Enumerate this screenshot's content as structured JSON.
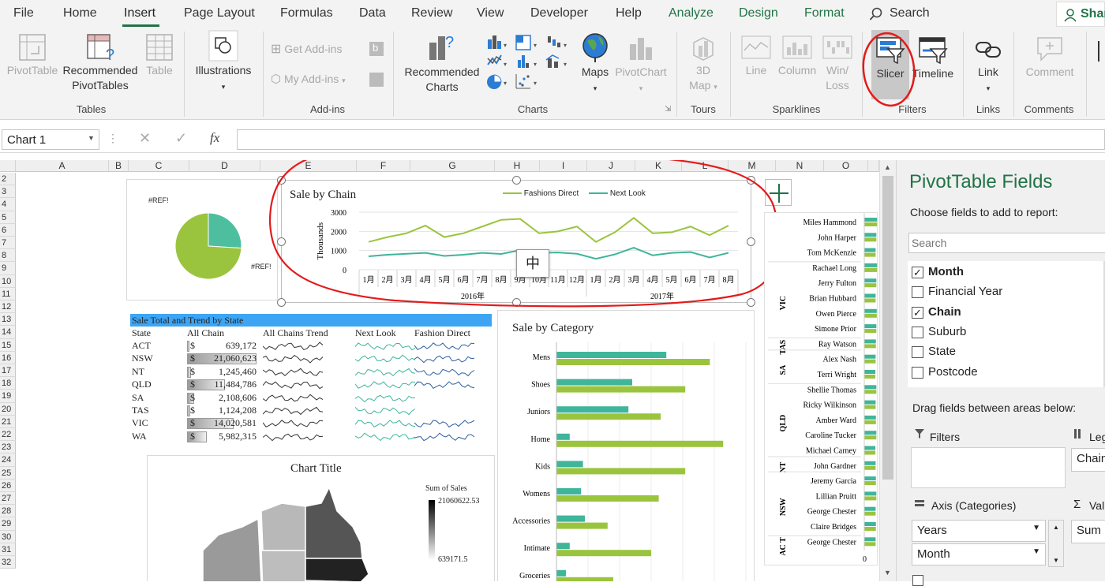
{
  "tabs": [
    "File",
    "Home",
    "Insert",
    "Page Layout",
    "Formulas",
    "Data",
    "Review",
    "View",
    "Developer",
    "Help",
    "Analyze",
    "Design",
    "Format"
  ],
  "search_label": "Search",
  "share_label": "Shar",
  "ribbon": {
    "pivottable": "PivotTable",
    "recommended_pivottables_1": "Recommended",
    "recommended_pivottables_2": "PivotTables",
    "table": "Table",
    "illustrations": "Illustrations",
    "get_addins": "Get Add-ins",
    "my_addins": "My Add-ins",
    "recommended_charts_1": "Recommended",
    "recommended_charts_2": "Charts",
    "maps": "Maps",
    "pivotchart": "PivotChart",
    "map3d_1": "3D",
    "map3d_2": "Map",
    "line": "Line",
    "column": "Column",
    "winloss_1": "Win/",
    "winloss_2": "Loss",
    "slicer": "Slicer",
    "timeline": "Timeline",
    "link": "Link",
    "comment": "Comment",
    "groups": {
      "tables": "Tables",
      "addins": "Add-ins",
      "charts": "Charts",
      "tours": "Tours",
      "sparklines": "Sparklines",
      "filters": "Filters",
      "links": "Links",
      "comments": "Comments"
    }
  },
  "namebox": "Chart 1",
  "fx": "fx",
  "columns": [
    "A",
    "B",
    "C",
    "D",
    "E",
    "F",
    "G",
    "H",
    "I",
    "J",
    "K",
    "L",
    "M",
    "N",
    "O"
  ],
  "rows": [
    "2",
    "3",
    "4",
    "5",
    "6",
    "7",
    "8",
    "9",
    "10",
    "11",
    "12",
    "13",
    "14",
    "15",
    "16",
    "17",
    "18",
    "19",
    "20",
    "21",
    "22",
    "23",
    "24",
    "25",
    "26",
    "27",
    "28",
    "29",
    "30",
    "31",
    "32"
  ],
  "pie_labels": [
    "#REF!",
    "#REF!"
  ],
  "line_chart": {
    "title": "Sale by Chain",
    "ylabel": "Thousands",
    "legend": [
      "Fashions Direct",
      "Next Look"
    ],
    "yticks": [
      "3000",
      "2000",
      "1000",
      "0"
    ],
    "months": [
      "1月",
      "2月",
      "3月",
      "4月",
      "5月",
      "6月",
      "7月",
      "8月",
      "9月",
      "10月",
      "11月",
      "12月",
      "1月",
      "2月",
      "3月",
      "4月",
      "5月",
      "6月",
      "7月",
      "8月"
    ],
    "years": [
      "2016年",
      "2017年"
    ],
    "ime": "中"
  },
  "chart_data": [
    {
      "type": "line",
      "title": "Sale by Chain",
      "ylabel": "Thousands",
      "ylim": [
        0,
        3000
      ],
      "categories": [
        "1月",
        "2月",
        "3月",
        "4月",
        "5月",
        "6月",
        "7月",
        "8月",
        "9月",
        "10月",
        "11月",
        "12月",
        "1月",
        "2月",
        "3月",
        "4月",
        "5月",
        "6月",
        "7月",
        "8月"
      ],
      "series": [
        {
          "name": "Fashions Direct",
          "values": [
            1450,
            1700,
            1900,
            2300,
            1700,
            1900,
            2250,
            2600,
            2650,
            1900,
            2000,
            2250,
            1450,
            1950,
            2700,
            1900,
            1950,
            2250,
            1800,
            2300
          ]
        },
        {
          "name": "Next Look",
          "values": [
            700,
            780,
            830,
            880,
            720,
            780,
            880,
            820,
            1020,
            880,
            900,
            830,
            570,
            800,
            1150,
            750,
            880,
            920,
            640,
            880
          ]
        }
      ]
    },
    {
      "type": "bar",
      "title": "Sale by Category",
      "categories": [
        "Mens",
        "Shoes",
        "Juniors",
        "Home",
        "Kids",
        "Womens",
        "Accessories",
        "Intimate",
        "Groceries"
      ],
      "series": [
        {
          "values": [
            0.58,
            0.4,
            0.38,
            0.07,
            0.14,
            0.13,
            0.15,
            0.07,
            0.05
          ]
        },
        {
          "values": [
            0.81,
            0.68,
            0.55,
            0.88,
            0.68,
            0.54,
            0.27,
            0.5,
            0.3
          ]
        }
      ]
    },
    {
      "type": "pie",
      "values": [
        26,
        74
      ]
    },
    {
      "type": "table",
      "title": "Sale Total and Trend by State",
      "columns": [
        "State",
        "All Chain",
        "All Chains Trend",
        "Next Look",
        "Fashion Direct"
      ],
      "rows": [
        [
          "ACT",
          "639,172"
        ],
        [
          "NSW",
          "21,060,623"
        ],
        [
          "NT",
          "1,245,460"
        ],
        [
          "QLD",
          "11,484,786"
        ],
        [
          "SA",
          "2,108,606"
        ],
        [
          "TAS",
          "1,124,208"
        ],
        [
          "VIC",
          "14,020,581"
        ],
        [
          "WA",
          "5,982,315"
        ]
      ]
    }
  ],
  "state_table": {
    "title": "Sale Total and Trend by State",
    "headers": [
      "State",
      "All Chain",
      "All Chains Trend",
      "Next Look",
      "Fashion Direct"
    ],
    "rows": [
      {
        "state": "ACT",
        "cur": "$",
        "val": "639,172",
        "bar": 0.03
      },
      {
        "state": "NSW",
        "cur": "$",
        "val": "21,060,623",
        "bar": 1.0
      },
      {
        "state": "NT",
        "cur": "$",
        "val": "1,245,460",
        "bar": 0.06
      },
      {
        "state": "QLD",
        "cur": "$",
        "val": "11,484,786",
        "bar": 0.55
      },
      {
        "state": "SA",
        "cur": "$",
        "val": "2,108,606",
        "bar": 0.1
      },
      {
        "state": "TAS",
        "cur": "$",
        "val": "1,124,208",
        "bar": 0.05
      },
      {
        "state": "VIC",
        "cur": "$",
        "val": "14,020,581",
        "bar": 0.67
      },
      {
        "state": "WA",
        "cur": "$",
        "val": "5,982,315",
        "bar": 0.28
      }
    ]
  },
  "category_chart": {
    "title": "Sale by Category",
    "cats": [
      "Mens",
      "Shoes",
      "Juniors",
      "Home",
      "Kids",
      "Womens",
      "Accessories",
      "Intimate",
      "Groceries"
    ]
  },
  "map_chart": {
    "title": "Chart Title",
    "legend_title": "Sum of Sales",
    "max": "21060622.53",
    "min": "639171.5"
  },
  "people": [
    {
      "name": "Miles Hammond",
      "v": 0.9
    },
    {
      "name": "John Harper",
      "v": 0.85
    },
    {
      "name": "Tom McKenzie",
      "v": 0.8
    },
    {
      "name": "Rachael Long",
      "v": 0.9
    },
    {
      "name": "Jerry Fulton",
      "v": 0.85
    },
    {
      "name": "Brian Hubbard",
      "v": 0.8
    },
    {
      "name": "Owen Pierce",
      "v": 0.88
    },
    {
      "name": "Simone Prior",
      "v": 0.85
    },
    {
      "name": "Ray Watson",
      "v": 0.82
    },
    {
      "name": "Alex Nash",
      "v": 0.8
    },
    {
      "name": "Terri Wright",
      "v": 0.78
    },
    {
      "name": "Shellie Thomas",
      "v": 0.85
    },
    {
      "name": "Ricky Wilkinson",
      "v": 0.8
    },
    {
      "name": "Amber Ward",
      "v": 0.82
    },
    {
      "name": "Caroline Tucker",
      "v": 0.85
    },
    {
      "name": "Michael Carney",
      "v": 0.78
    },
    {
      "name": "John Gardner",
      "v": 0.8
    },
    {
      "name": "Jeremy Garcia",
      "v": 0.82
    },
    {
      "name": "Lillian Pruitt",
      "v": 0.85
    },
    {
      "name": "George Chester",
      "v": 0.8
    },
    {
      "name": "Claire Bridges",
      "v": 0.82
    },
    {
      "name": "George Chester",
      "v": 0.8
    }
  ],
  "people_groups": [
    {
      "label": "VIC"
    },
    {
      "label": "TAS"
    },
    {
      "label": "SA"
    },
    {
      "label": "QLD"
    },
    {
      "label": "NT"
    },
    {
      "label": "NSW"
    },
    {
      "label": "AC T"
    }
  ],
  "people_axis_zero": "0",
  "pivot": {
    "title": "PivotTable Fields",
    "subtitle": "Choose fields to add to report:",
    "search_placeholder": "Search",
    "fields": [
      {
        "label": "Month",
        "checked": true
      },
      {
        "label": "Financial Year",
        "checked": false
      },
      {
        "label": "Chain",
        "checked": true
      },
      {
        "label": "Suburb",
        "checked": false
      },
      {
        "label": "State",
        "checked": false
      },
      {
        "label": "Postcode",
        "checked": false
      }
    ],
    "drag_label": "Drag fields between areas below:",
    "filters": "Filters",
    "legend": "Leg",
    "legend_item": "Chain",
    "axis": "Axis (Categories)",
    "values": "Val",
    "axis_items": [
      "Years",
      "Month"
    ],
    "values_item": "Sum"
  },
  "colors": {
    "green": "#217346",
    "fashions": "#9bc43e",
    "nextlook": "#3fb59a",
    "annot": "#e31b1b",
    "tableHeader": "#3da5f4"
  }
}
